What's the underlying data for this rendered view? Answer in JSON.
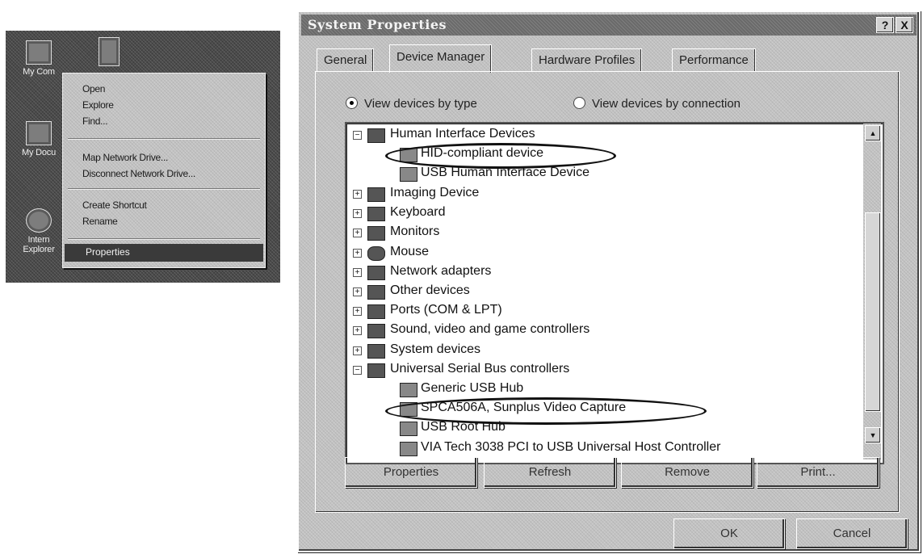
{
  "desktop": {
    "icons": [
      {
        "label": "My Com"
      },
      {
        "label": "My Docu"
      },
      {
        "label": "Intern"
      },
      {
        "label": "Explorer"
      }
    ],
    "context_menu": {
      "items": [
        "Open",
        "Explore",
        "Find...",
        "Map Network Drive...",
        "Disconnect Network Drive...",
        "Create Shortcut",
        "Rename",
        "Properties"
      ]
    }
  },
  "dialog": {
    "title": "System Properties",
    "help_button": "?",
    "close_button": "X",
    "tabs": [
      "General",
      "Device Manager",
      "Hardware Profiles",
      "Performance"
    ],
    "active_tab": "Device Manager",
    "view_options": {
      "by_type": "View devices by type",
      "by_connection": "View devices by connection",
      "selected": "View devices by type"
    },
    "device_tree": [
      {
        "label": "Human Interface Devices",
        "expanded": true,
        "level": 0
      },
      {
        "label": "HID-compliant device",
        "level": 1,
        "highlighted": true
      },
      {
        "label": "USB Human Interface Device",
        "level": 1
      },
      {
        "label": "Imaging Device",
        "level": 0
      },
      {
        "label": "Keyboard",
        "level": 0
      },
      {
        "label": "Monitors",
        "level": 0
      },
      {
        "label": "Mouse",
        "level": 0
      },
      {
        "label": "Network adapters",
        "level": 0
      },
      {
        "label": "Other devices",
        "level": 0
      },
      {
        "label": "Ports (COM & LPT)",
        "level": 0
      },
      {
        "label": "Sound, video and game controllers",
        "level": 0
      },
      {
        "label": "System devices",
        "level": 0
      },
      {
        "label": "Universal Serial Bus controllers",
        "expanded": true,
        "level": 0
      },
      {
        "label": "Generic USB Hub",
        "level": 1
      },
      {
        "label": "SPCA506A, Sunplus Video Capture",
        "level": 1,
        "highlighted": true
      },
      {
        "label": "USB Root Hub",
        "level": 1
      },
      {
        "label": "VIA Tech 3038 PCI to USB Universal Host Controller",
        "level": 1
      }
    ],
    "buttons": {
      "properties": "Properties",
      "refresh": "Refresh",
      "remove": "Remove",
      "print": "Print...",
      "ok": "OK",
      "cancel": "Cancel"
    }
  }
}
